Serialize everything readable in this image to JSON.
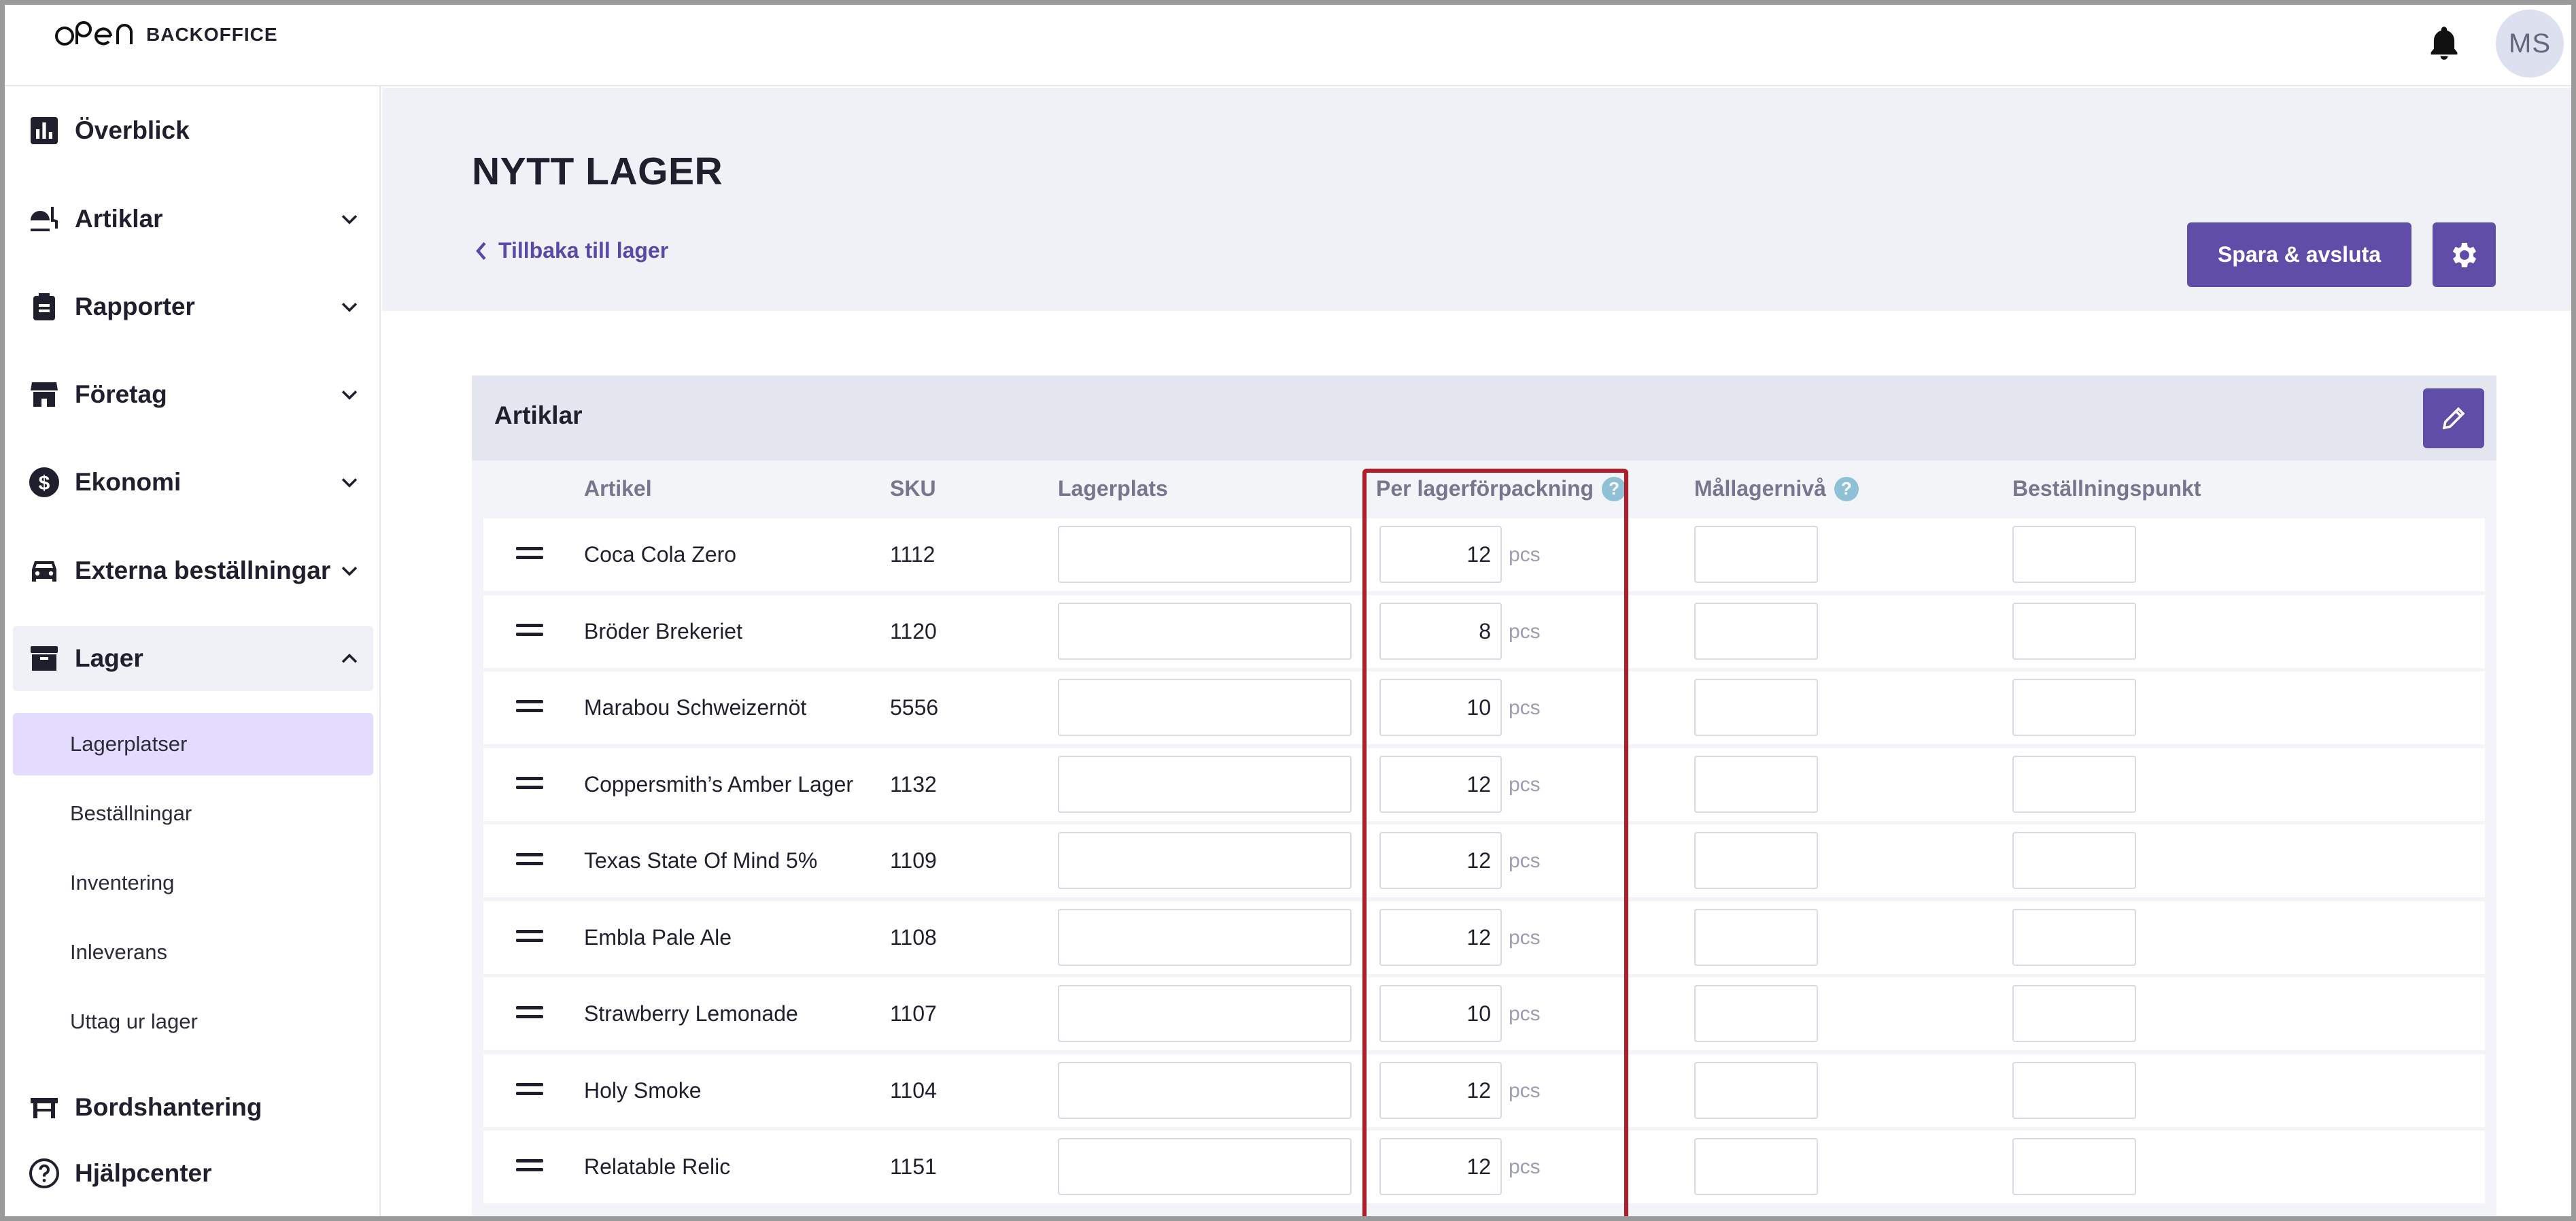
{
  "brand": {
    "logo_text": "BACKOFFICE"
  },
  "user": {
    "initials": "MS"
  },
  "sidebar": {
    "items": [
      {
        "label": "Överblick",
        "icon": "bar-chart-icon"
      },
      {
        "label": "Artiklar",
        "icon": "food-icon"
      },
      {
        "label": "Rapporter",
        "icon": "clipboard-icon"
      },
      {
        "label": "Företag",
        "icon": "store-icon"
      },
      {
        "label": "Ekonomi",
        "icon": "dollar-icon"
      },
      {
        "label": "Externa beställningar",
        "icon": "car-icon"
      },
      {
        "label": "Lager",
        "icon": "archive-icon"
      },
      {
        "label": "Bordshantering",
        "icon": "table-icon"
      },
      {
        "label": "Hjälpcenter",
        "icon": "help-circle-icon"
      }
    ],
    "lager_sub": [
      "Lagerplatser",
      "Beställningar",
      "Inventering",
      "Inleverans",
      "Uttag ur lager"
    ]
  },
  "header": {
    "title": "NYTT LAGER",
    "back_label": "Tillbaka till lager",
    "save_label": "Spara & avsluta"
  },
  "card": {
    "title": "Artiklar"
  },
  "table": {
    "columns": [
      "Artikel",
      "SKU",
      "Lagerplats",
      "Per lagerförpackning",
      "Mållagernivå",
      "Beställningspunkt"
    ],
    "help_mark": "?",
    "unit": "pcs",
    "rows": [
      {
        "name": "Coca Cola Zero",
        "sku": "1112",
        "per_pack": "12"
      },
      {
        "name": "Bröder Brekeriet",
        "sku": "1120",
        "per_pack": "8"
      },
      {
        "name": "Marabou Schweizernöt",
        "sku": "5556",
        "per_pack": "10"
      },
      {
        "name": "Coppersmith’s Amber Lager",
        "sku": "1132",
        "per_pack": "12"
      },
      {
        "name": "Texas State Of Mind 5%",
        "sku": "1109",
        "per_pack": "12"
      },
      {
        "name": "Embla Pale Ale",
        "sku": "1108",
        "per_pack": "12"
      },
      {
        "name": "Strawberry Lemonade",
        "sku": "1107",
        "per_pack": "10"
      },
      {
        "name": "Holy Smoke",
        "sku": "1104",
        "per_pack": "12"
      },
      {
        "name": "Relatable Relic",
        "sku": "1151",
        "per_pack": "12"
      }
    ]
  },
  "colors": {
    "accent": "#5f4da8",
    "highlight_border": "#b01c2a",
    "selected_bg": "#e4dcff"
  }
}
